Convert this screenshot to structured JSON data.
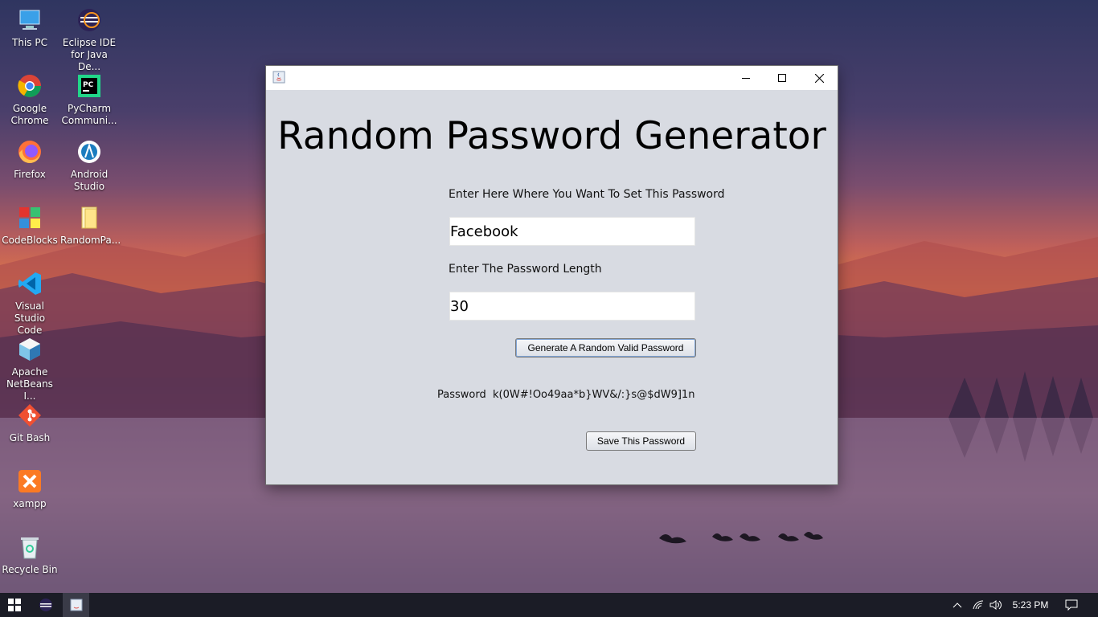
{
  "desktop": {
    "icons": [
      {
        "label": "This PC"
      },
      {
        "label": "Eclipse IDE\nfor Java De..."
      },
      {
        "label": "Google\nChrome"
      },
      {
        "label": "PyCharm\nCommuni..."
      },
      {
        "label": "Firefox"
      },
      {
        "label": "Android\nStudio"
      },
      {
        "label": "CodeBlocks"
      },
      {
        "label": "RandomPa..."
      },
      {
        "label": "Visual Studio\nCode"
      },
      {
        "label": "Apache\nNetBeans I..."
      },
      {
        "label": "Git Bash"
      },
      {
        "label": "xampp"
      },
      {
        "label": "Recycle Bin"
      }
    ]
  },
  "window": {
    "title": "",
    "heading": "Random Password Generator",
    "site_label": "Enter Here Where You Want To Set This Password",
    "site_value": "Facebook",
    "length_label": "Enter The Password Length",
    "length_value": "30",
    "generate_button": "Generate A Random Valid Password",
    "password_caption": "Password",
    "password_value": "k(0W#!Oo49aa*b}WV&/:}s@$dW9]1n",
    "save_button": "Save This Password"
  },
  "taskbar": {
    "clock": "5:23 PM"
  },
  "colors": {
    "window_bg": "#d8dbe2",
    "taskbar_bg": "#1b1c26"
  }
}
